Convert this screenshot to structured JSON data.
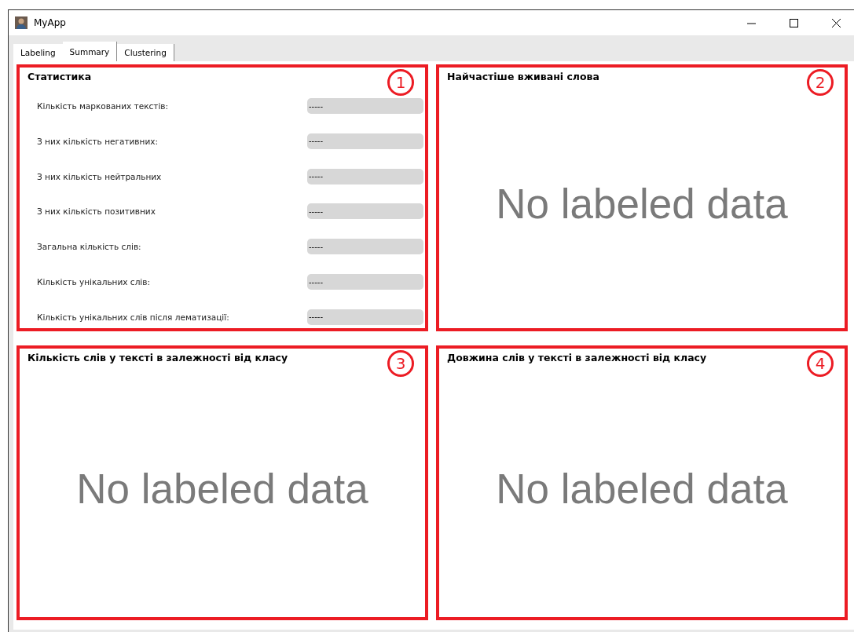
{
  "window": {
    "title": "MyApp"
  },
  "tabs": [
    {
      "label": "Labeling",
      "selected": false
    },
    {
      "label": "Summary",
      "selected": true
    },
    {
      "label": "Clustering",
      "selected": false
    }
  ],
  "panels": [
    {
      "kind": "stats",
      "number": "1",
      "title": "Статистика",
      "stats": [
        {
          "label": "Кількість маркованих текстів:",
          "value": "-----"
        },
        {
          "label": "З них кількість негативних:",
          "value": "-----"
        },
        {
          "label": "З них кількість нейтральних",
          "value": "-----"
        },
        {
          "label": "З них кількість позитивних",
          "value": "-----"
        },
        {
          "label": "Загальна кількість слів:",
          "value": "-----"
        },
        {
          "label": "Кількість унікальних слів:",
          "value": "-----"
        },
        {
          "label": "Кількість унікальних слів після лематизації:",
          "value": "-----"
        }
      ]
    },
    {
      "kind": "empty",
      "number": "2",
      "title": "Найчастіше вживані слова",
      "message": "No labeled data"
    },
    {
      "kind": "empty",
      "number": "3",
      "title": "Кількість слів у тексті в залежності від класу",
      "message": "No labeled data"
    },
    {
      "kind": "empty",
      "number": "4",
      "title": "Довжина слів у тексті в залежності від класу",
      "message": "No labeled data"
    }
  ]
}
